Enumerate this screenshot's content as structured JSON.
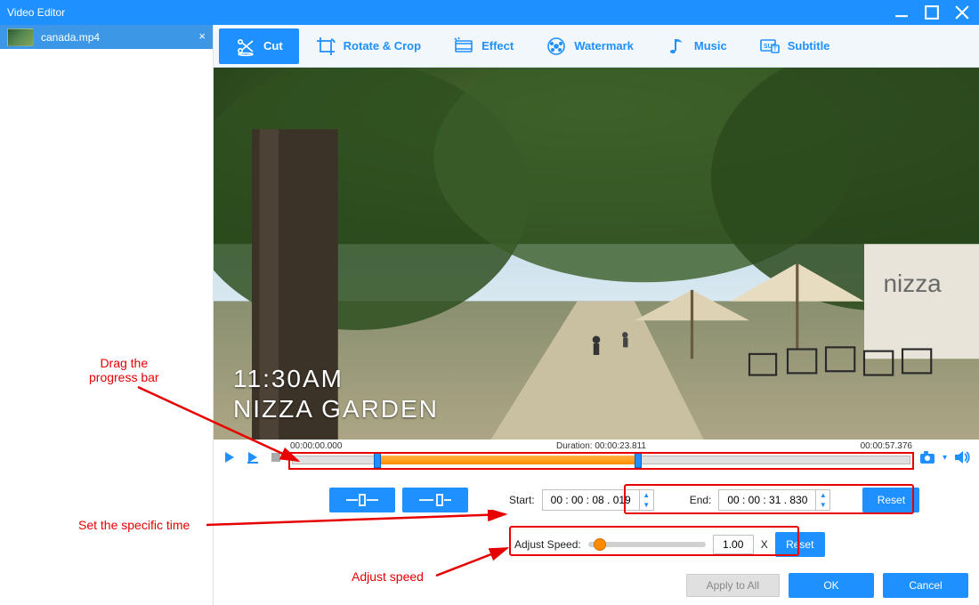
{
  "title": "Video Editor",
  "file": {
    "name": "canada.mp4"
  },
  "tabs": {
    "cut": "Cut",
    "rotate": "Rotate & Crop",
    "effect": "Effect",
    "watermark": "Watermark",
    "music": "Music",
    "subtitle": "Subtitle"
  },
  "preview": {
    "overlay_line1": "11:30AM",
    "overlay_line2": "NIZZA GARDEN"
  },
  "timeline": {
    "start_label": "00:00:00.000",
    "duration_label": "Duration: 00:00:23.811",
    "end_label": "00:00:57.376",
    "range_start_pct": 14,
    "range_end_pct": 56
  },
  "cut": {
    "start_label": "Start:",
    "start_value": "00 : 00 : 08 . 019",
    "end_label": "End:",
    "end_value": "00 : 00 : 31 . 830",
    "reset_label": "Reset",
    "speed_label": "Adjust Speed:",
    "speed_value": "1.00",
    "speed_unit": "X",
    "speed_reset": "Reset"
  },
  "annotations": {
    "drag": "Drag the\nprogress bar",
    "set_time": "Set the specific time",
    "adjust_speed": "Adjust speed"
  },
  "footer": {
    "apply_all": "Apply to All",
    "ok": "OK",
    "cancel": "Cancel"
  }
}
